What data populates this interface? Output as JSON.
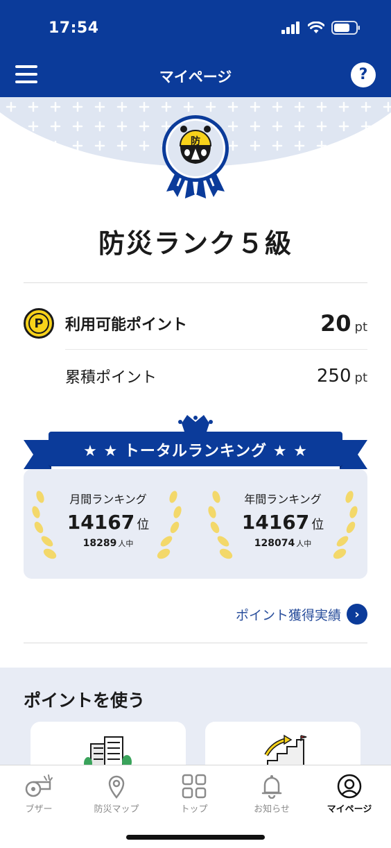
{
  "status_bar": {
    "time": "17:54"
  },
  "header": {
    "title": "マイページ",
    "help_label": "?"
  },
  "medal": {
    "badge_char": "防"
  },
  "rank": {
    "title": "防災ランク５級"
  },
  "points": {
    "available_label": "利用可能ポイント",
    "available_value": "20",
    "available_unit": "pt",
    "coin_letter": "P",
    "cumulative_label": "累積ポイント",
    "cumulative_value": "250",
    "cumulative_unit": "pt"
  },
  "ranking": {
    "title": "★ ★  トータルランキング  ★ ★",
    "monthly": {
      "label": "月間ランキング",
      "value": "14167",
      "unit": "位",
      "total": "18289",
      "total_unit": "人中"
    },
    "yearly": {
      "label": "年間ランキング",
      "value": "14167",
      "unit": "位",
      "total": "128074",
      "total_unit": "人中"
    }
  },
  "history_link": {
    "label": "ポイント獲得実績",
    "arrow": "›"
  },
  "use_points": {
    "title": "ポイントを使う"
  },
  "tabbar": {
    "items": [
      {
        "label": "ブザー",
        "icon": "whistle-icon"
      },
      {
        "label": "防災マップ",
        "icon": "map-pin-icon"
      },
      {
        "label": "トップ",
        "icon": "grid-icon"
      },
      {
        "label": "お知らせ",
        "icon": "bell-icon"
      },
      {
        "label": "マイページ",
        "icon": "profile-icon"
      }
    ]
  },
  "colors": {
    "primary": "#0b3b9a",
    "accent_yellow": "#f7d21a",
    "card_bg": "#e8ecf5",
    "link": "#2a4f9c"
  }
}
